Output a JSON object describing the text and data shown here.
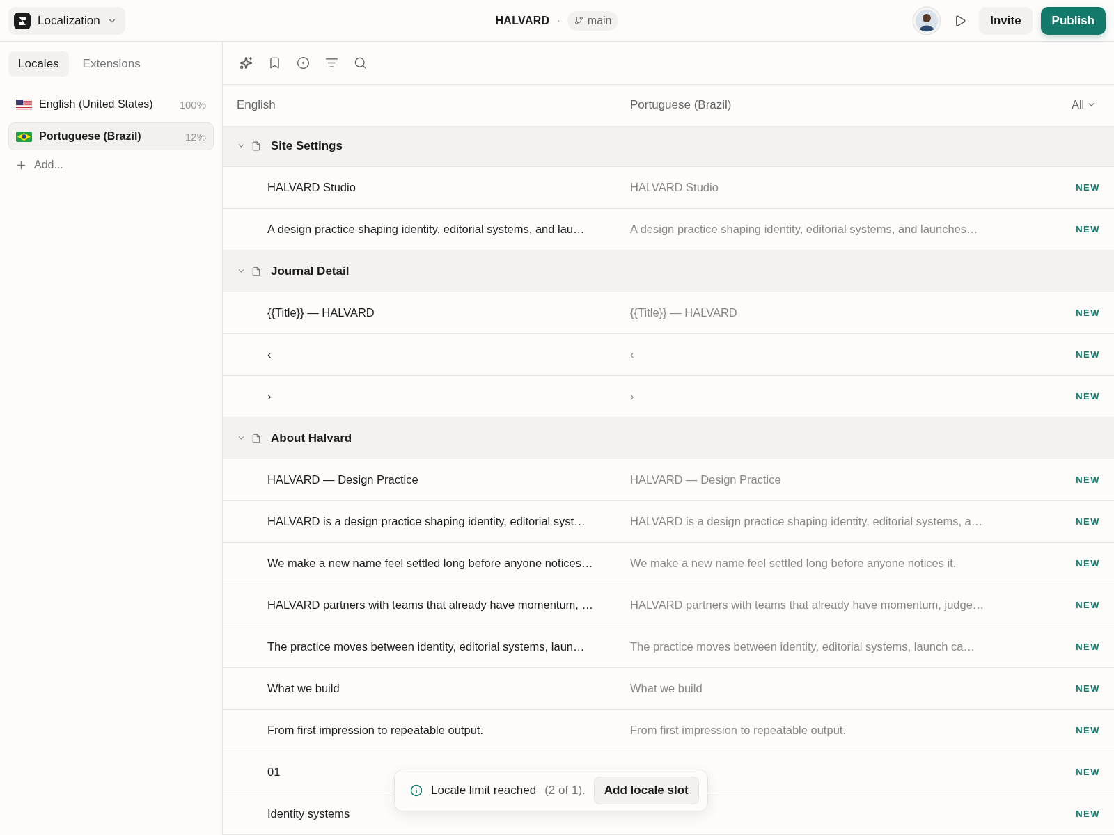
{
  "topbar": {
    "app_menu": "Localization",
    "project": "HALVARD",
    "separator": "·",
    "branch": "main",
    "invite": "Invite",
    "publish": "Publish"
  },
  "sidebar": {
    "tabs": [
      {
        "label": "Locales",
        "selected": true
      },
      {
        "label": "Extensions",
        "selected": false
      }
    ],
    "locales": [
      {
        "kind": "us",
        "name": "English (United States)",
        "percent": "100%",
        "selected": false
      },
      {
        "kind": "br",
        "name": "Portuguese (Brazil)",
        "percent": "12%",
        "selected": true
      }
    ],
    "add": "Add..."
  },
  "table": {
    "columns": [
      "English",
      "Portuguese (Brazil)"
    ],
    "filter": "All",
    "rows": [
      {
        "kind": "group",
        "title": "Site Settings",
        "expanded": true
      },
      {
        "kind": "entry",
        "source": "HALVARD Studio",
        "target": "HALVARD Studio",
        "status": "NEW"
      },
      {
        "kind": "entry",
        "source": "A design practice shaping identity, editorial systems, and lau…",
        "target": "A design practice shaping identity, editorial systems, and launches…",
        "status": "NEW"
      },
      {
        "kind": "group",
        "title": "Journal Detail",
        "expanded": true
      },
      {
        "kind": "entry",
        "source": "{{Title}} — HALVARD",
        "target": "{{Title}} — HALVARD",
        "status": "NEW"
      },
      {
        "kind": "entry",
        "source": "‹",
        "target": "‹",
        "status": "NEW"
      },
      {
        "kind": "entry",
        "source": "›",
        "target": "›",
        "status": "NEW"
      },
      {
        "kind": "group",
        "title": "About Halvard",
        "expanded": true
      },
      {
        "kind": "entry",
        "source": "HALVARD — Design Practice",
        "target": "HALVARD — Design Practice",
        "status": "NEW"
      },
      {
        "kind": "entry",
        "source": "HALVARD is a design practice shaping identity, editorial syst…",
        "target": "HALVARD is a design practice shaping identity, editorial systems, a…",
        "status": "NEW"
      },
      {
        "kind": "entry",
        "source": "We make a new name feel settled long before anyone notices…",
        "target": "We make a new name feel settled long before anyone notices it.",
        "status": "NEW"
      },
      {
        "kind": "entry",
        "source": "HALVARD partners with teams that already have momentum, …",
        "target": "HALVARD partners with teams that already have momentum, judge…",
        "status": "NEW"
      },
      {
        "kind": "entry",
        "source": "The practice moves between identity, editorial systems, laun…",
        "target": "The practice moves between identity, editorial systems, launch ca…",
        "status": "NEW"
      },
      {
        "kind": "entry",
        "source": "What we build",
        "target": "What we build",
        "status": "NEW"
      },
      {
        "kind": "entry",
        "source": "From first impression to repeatable output.",
        "target": "From first impression to repeatable output.",
        "status": "NEW"
      },
      {
        "kind": "entry",
        "source": "01",
        "status": "NEW"
      },
      {
        "kind": "entry",
        "source": "Identity systems",
        "status": "NEW"
      }
    ]
  },
  "toast": {
    "message": "Locale limit reached",
    "count": "(2 of 1).",
    "action": "Add locale slot"
  }
}
